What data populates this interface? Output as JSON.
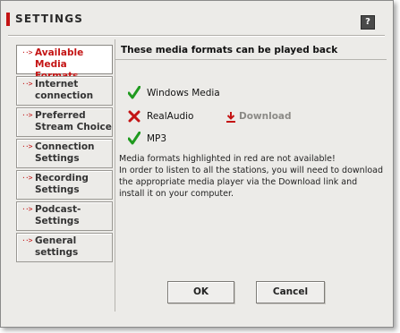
{
  "window": {
    "title": "SETTINGS",
    "help_label": "?"
  },
  "nav": {
    "arrow_glyph": "··>",
    "items": [
      {
        "label": "Available\nMedia Formats",
        "active": true
      },
      {
        "label": "Internet\nconnection",
        "active": false
      },
      {
        "label": "Preferred\nStream Choice",
        "active": false
      },
      {
        "label": "Connection\nSettings",
        "active": false
      },
      {
        "label": "Recording\nSettings",
        "active": false
      },
      {
        "label": "Podcast-\nSettings",
        "active": false
      },
      {
        "label": "General\nsettings",
        "active": false
      }
    ]
  },
  "panel": {
    "heading": "These media formats can be played back",
    "formats": [
      {
        "name": "Windows Media",
        "available": true,
        "icon": "check-icon"
      },
      {
        "name": "RealAudio",
        "available": false,
        "icon": "cross-icon"
      },
      {
        "name": "MP3",
        "available": true,
        "icon": "check-icon"
      }
    ],
    "download_label": "Download",
    "info_line1": "Media formats highlighted in red are not available!",
    "info_line2": "In order to listen to all the stations, you will need to download the appropriate media player via the Download link and install it on your computer."
  },
  "buttons": {
    "ok_label": "OK",
    "cancel_label": "Cancel"
  },
  "colors": {
    "accent": "#c41414",
    "check": "#1f9a1f",
    "background": "#ecebe8",
    "download_disabled": "#8b8a86"
  }
}
